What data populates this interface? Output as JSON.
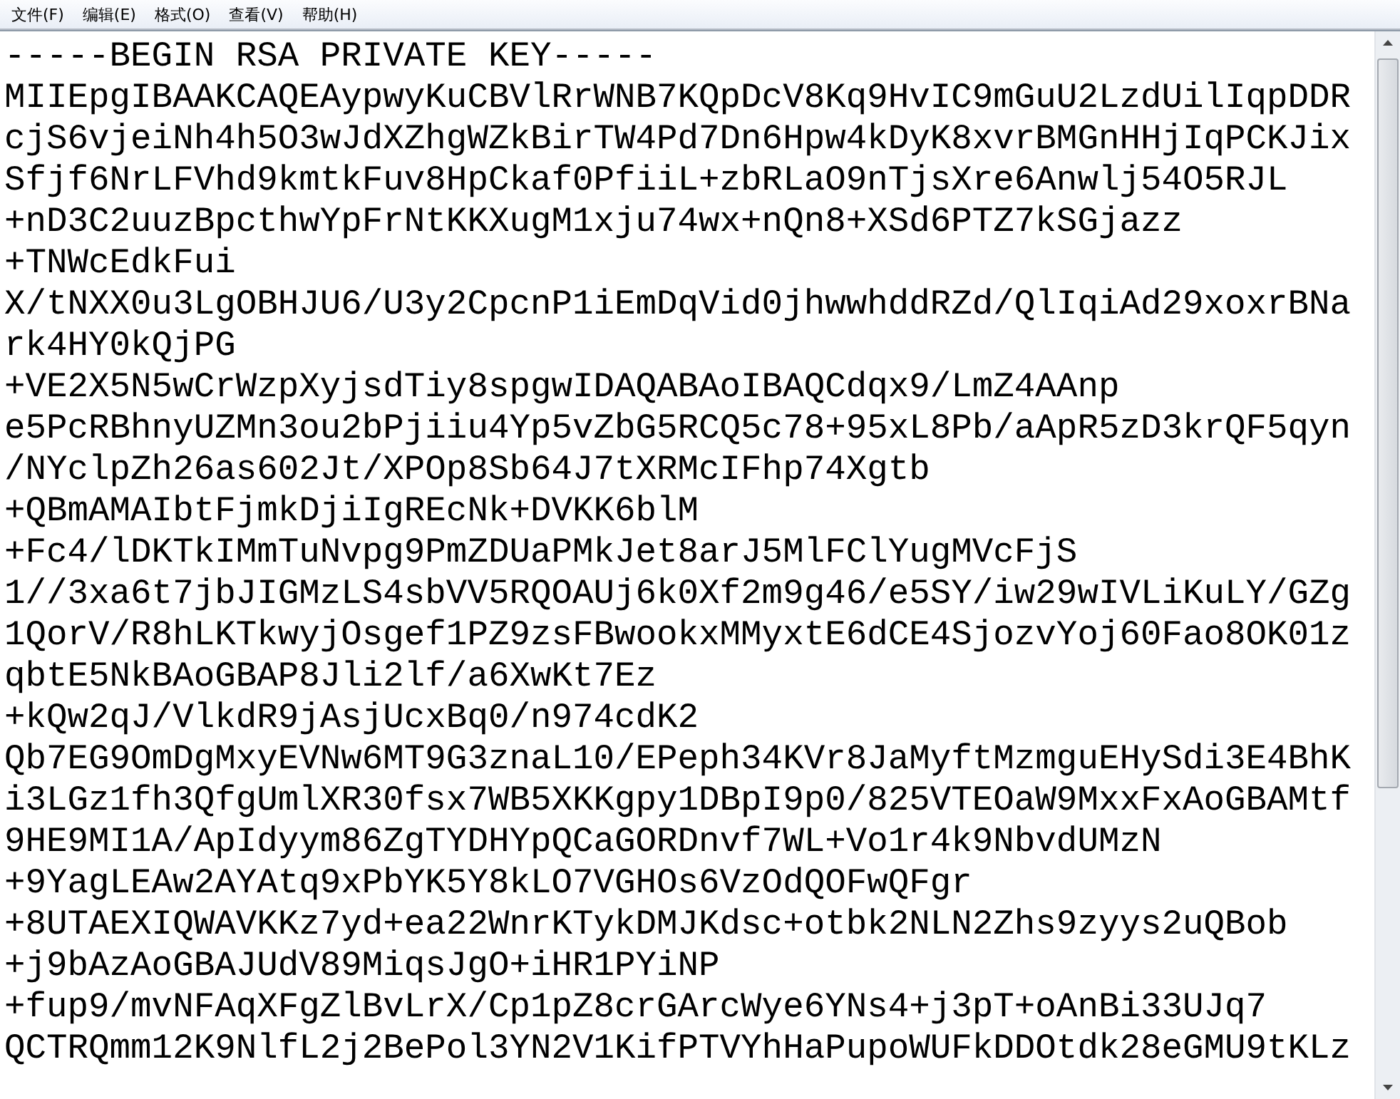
{
  "menu_bar": [
    {
      "label": "文件(F)"
    },
    {
      "label": "编辑(E)"
    },
    {
      "label": "格式(O)"
    },
    {
      "label": "查看(V)"
    },
    {
      "label": "帮助(H)"
    }
  ],
  "editor": {
    "lines": [
      "-----BEGIN RSA PRIVATE KEY-----",
      "MIIEpgIBAAKCAQEAypwyKuCBVlRrWNB7KQpDcV8Kq9HvIC9mGuU2LzdUilIqpDDR",
      "cjS6vjeiNh4h5O3wJdXZhgWZkBirTW4Pd7Dn6Hpw4kDyK8xvrBMGnHHjIqPCKJix",
      "Sfjf6NrLFVhd9kmtkFuv8HpCkaf0PfiiL+zbRLaO9nTjsXre6Anwlj54O5RJL",
      "+nD3C2uuzBpcthwYpFrNtKKXugM1xju74wx+nQn8+XSd6PTZ7kSGjazz",
      "+TNWcEdkFui",
      "X/tNXX0u3LgOBHJU6/U3y2CpcnP1iEmDqVid0jhwwhddRZd/QlIqiAd29xoxrBNa",
      "rk4HY0kQjPG",
      "+VE2X5N5wCrWzpXyjsdTiy8spgwIDAQABAoIBAQCdqx9/LmZ4AAnp",
      "e5PcRBhnyUZMn3ou2bPjiiu4Yp5vZbG5RCQ5c78+95xL8Pb/aApR5zD3krQF5qyn",
      "/NYclpZh26as602Jt/XPOp8Sb64J7tXRMcIFhp74Xgtb",
      "+QBmAMAIbtFjmkDjiIgREcNk+DVKK6blM",
      "+Fc4/lDKTkIMmTuNvpg9PmZDUaPMkJet8arJ5MlFClYugMVcFjS",
      "1//3xa6t7jbJIGMzLS4sbVV5RQOAUj6k0Xf2m9g46/e5SY/iw29wIVLiKuLY/GZg",
      "1QorV/R8hLKTkwyjOsgef1PZ9zsFBwookxMMyxtE6dCE4SjozvYoj60Fao8OK01z",
      "qbtE5NkBAoGBAP8Jli2lf/a6XwKt7Ez",
      "+kQw2qJ/VlkdR9jAsjUcxBq0/n974cdK2",
      "Qb7EG9OmDgMxyEVNw6MT9G3znaL10/EPeph34KVr8JaMyftMzmguEHySdi3E4BhK",
      "i3LGz1fh3QfgUmlXR30fsx7WB5XKKgpy1DBpI9p0/825VTEOaW9MxxFxAoGBAMtf",
      "9HE9MI1A/ApIdyym86ZgTYDHYpQCaGORDnvf7WL+Vo1r4k9NbvdUMzN",
      "+9YagLEAw2AYAtq9xPbYK5Y8kLO7VGHOs6VzOdQOFwQFgr",
      "+8UTAEXIQWAVKKz7yd+ea22WnrKTykDMJKdsc+otbk2NLN2Zhs9zyys2uQBob",
      "+j9bAzAoGBAJUdV89MiqsJgO+iHR1PYiNP",
      "+fup9/mvNFAqXFgZlBvLrX/Cp1pZ8crGArcWye6YNs4+j3pT+oAnBi33UJq7",
      "QCTRQmm12K9NlfL2j2BePol3YN2V1KifPTVYhHaPupoWUFkDDOtdk28eGMU9tKLz"
    ]
  }
}
